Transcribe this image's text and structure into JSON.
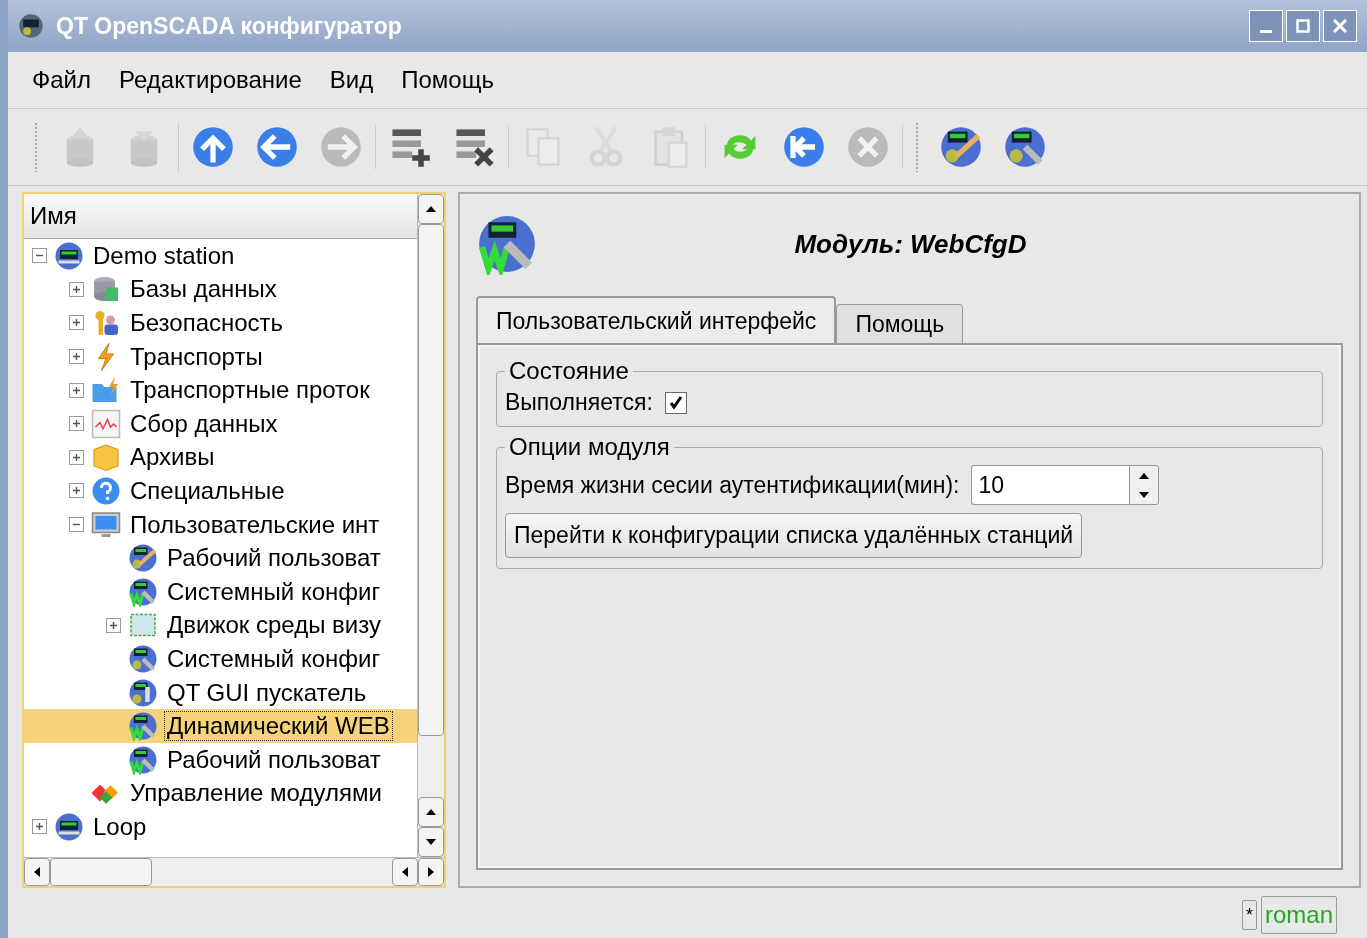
{
  "window": {
    "title": "QT OpenSCADA конфигуратор"
  },
  "menu": [
    {
      "label": "Файл"
    },
    {
      "label": "Редактирование"
    },
    {
      "label": "Вид"
    },
    {
      "label": "Помощь"
    }
  ],
  "toolbar": [
    [
      {
        "kind": "db-load",
        "disabled": true
      },
      {
        "kind": "db-save",
        "disabled": true
      }
    ],
    [
      {
        "kind": "up",
        "disabled": false
      },
      {
        "kind": "back",
        "disabled": false
      },
      {
        "kind": "forward",
        "disabled": true
      }
    ],
    [
      {
        "kind": "add",
        "disabled": false
      },
      {
        "kind": "delete",
        "disabled": false
      }
    ],
    [
      {
        "kind": "copy",
        "disabled": true
      },
      {
        "kind": "cut",
        "disabled": true
      },
      {
        "kind": "paste",
        "disabled": true
      }
    ],
    [
      {
        "kind": "refresh",
        "disabled": false
      },
      {
        "kind": "start",
        "disabled": false
      },
      {
        "kind": "stop",
        "disabled": true
      }
    ],
    [
      {
        "kind": "ui-pen",
        "disabled": false
      },
      {
        "kind": "ui-wrench",
        "disabled": false
      }
    ]
  ],
  "tree": {
    "header": "Имя",
    "items": [
      {
        "label": "Demo station",
        "kind": "station",
        "expanded": true,
        "selected": false,
        "children": [
          {
            "label": "Базы данных",
            "kind": "db",
            "expanded": false,
            "selected": false
          },
          {
            "label": "Безопасность",
            "kind": "security",
            "expanded": false,
            "selected": false
          },
          {
            "label": "Транспорты",
            "kind": "bolt",
            "expanded": false,
            "selected": false
          },
          {
            "label": "Транспортные проток",
            "kind": "folder",
            "expanded": false,
            "selected": false
          },
          {
            "label": "Сбор данных",
            "kind": "chart",
            "expanded": false,
            "selected": false
          },
          {
            "label": "Архивы",
            "kind": "box",
            "expanded": false,
            "selected": false
          },
          {
            "label": "Специальные",
            "kind": "help",
            "expanded": false,
            "selected": false
          },
          {
            "label": "Пользовательские инт",
            "kind": "monitor",
            "expanded": true,
            "selected": false,
            "children": [
              {
                "label": "Рабочий пользоват",
                "kind": "ui-pen",
                "selected": false
              },
              {
                "label": "Системный конфиг",
                "kind": "ui-web",
                "selected": false
              },
              {
                "label": "Движок среды визу",
                "kind": "cube",
                "expanded": false,
                "selected": false
              },
              {
                "label": "Системный конфиг",
                "kind": "ui-wrench",
                "selected": false
              },
              {
                "label": "QT GUI пускатель",
                "kind": "ui-launch",
                "selected": false
              },
              {
                "label": "Динамический WEB",
                "kind": "ui-web",
                "selected": true
              },
              {
                "label": "Рабочий пользоват",
                "kind": "ui-web",
                "selected": false
              }
            ]
          },
          {
            "label": "Управление модулями",
            "kind": "modules",
            "selected": false
          }
        ]
      },
      {
        "label": "Loop",
        "kind": "station",
        "expanded": false,
        "selected": false
      }
    ]
  },
  "page": {
    "title": "Модуль: WebCfgD",
    "tabs": [
      {
        "label": "Пользовательский интерфейс",
        "selected": true
      },
      {
        "label": "Помощь",
        "selected": false
      }
    ],
    "groups": [
      {
        "title": "Состояние",
        "fields": [
          {
            "kind": "checkbox",
            "label": "Выполняется:",
            "checked": true
          }
        ]
      },
      {
        "title": "Опции модуля",
        "fields": [
          {
            "kind": "spinbox",
            "label": "Время жизни сесии аутентификации(мин):",
            "value": "10"
          },
          {
            "kind": "button",
            "label": "Перейти к конфигурации списка удалённых станций"
          }
        ]
      }
    ]
  },
  "status_bar": {
    "modified": "*",
    "user": "roman"
  }
}
